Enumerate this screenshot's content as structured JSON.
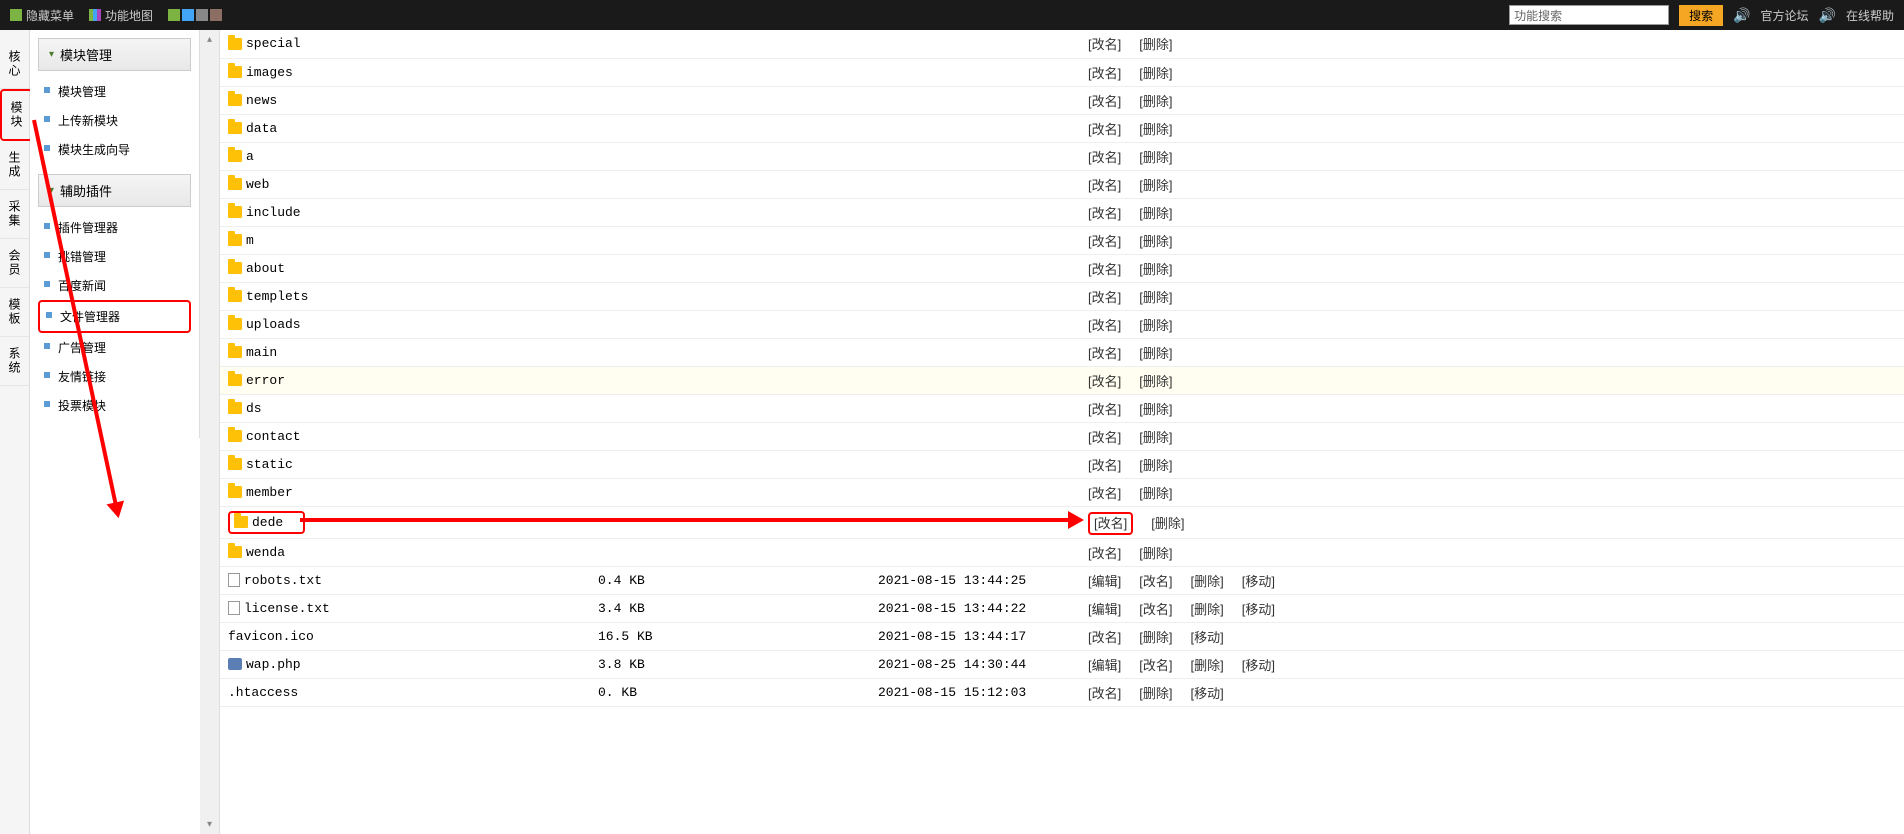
{
  "topbar": {
    "hide_menu": "隐藏菜单",
    "feature_map": "功能地图",
    "search_placeholder": "功能搜索",
    "search_btn": "搜索",
    "official_forum": "官方论坛",
    "online_help": "在线帮助"
  },
  "left_tabs": [
    "核心",
    "模块",
    "生成",
    "采集",
    "会员",
    "模板",
    "系统"
  ],
  "sidebar": {
    "group1_title": "模块管理",
    "group1_items": [
      "模块管理",
      "上传新模块",
      "模块生成向导"
    ],
    "group2_title": "辅助插件",
    "group2_items": [
      "插件管理器",
      "挑错管理",
      "百度新闻",
      "文件管理器",
      "广告管理",
      "友情链接",
      "投票模块"
    ]
  },
  "ops_labels": {
    "rename": "[改名]",
    "delete": "[删除]",
    "edit": "[编辑]",
    "move": "[移动]"
  },
  "files": [
    {
      "type": "folder",
      "name": "special",
      "size": "",
      "date": "",
      "ops": [
        "rename",
        "delete"
      ]
    },
    {
      "type": "folder",
      "name": "images",
      "size": "",
      "date": "",
      "ops": [
        "rename",
        "delete"
      ]
    },
    {
      "type": "folder",
      "name": "news",
      "size": "",
      "date": "",
      "ops": [
        "rename",
        "delete"
      ]
    },
    {
      "type": "folder",
      "name": "data",
      "size": "",
      "date": "",
      "ops": [
        "rename",
        "delete"
      ]
    },
    {
      "type": "folder",
      "name": "a",
      "size": "",
      "date": "",
      "ops": [
        "rename",
        "delete"
      ]
    },
    {
      "type": "folder",
      "name": "web",
      "size": "",
      "date": "",
      "ops": [
        "rename",
        "delete"
      ]
    },
    {
      "type": "folder",
      "name": "include",
      "size": "",
      "date": "",
      "ops": [
        "rename",
        "delete"
      ]
    },
    {
      "type": "folder",
      "name": "m",
      "size": "",
      "date": "",
      "ops": [
        "rename",
        "delete"
      ]
    },
    {
      "type": "folder",
      "name": "about",
      "size": "",
      "date": "",
      "ops": [
        "rename",
        "delete"
      ]
    },
    {
      "type": "folder",
      "name": "templets",
      "size": "",
      "date": "",
      "ops": [
        "rename",
        "delete"
      ]
    },
    {
      "type": "folder",
      "name": "uploads",
      "size": "",
      "date": "",
      "ops": [
        "rename",
        "delete"
      ]
    },
    {
      "type": "folder",
      "name": "main",
      "size": "",
      "date": "",
      "ops": [
        "rename",
        "delete"
      ]
    },
    {
      "type": "folder",
      "name": "error",
      "size": "",
      "date": "",
      "ops": [
        "rename",
        "delete"
      ],
      "error": true
    },
    {
      "type": "folder",
      "name": "ds",
      "size": "",
      "date": "",
      "ops": [
        "rename",
        "delete"
      ]
    },
    {
      "type": "folder",
      "name": "contact",
      "size": "",
      "date": "",
      "ops": [
        "rename",
        "delete"
      ]
    },
    {
      "type": "folder",
      "name": "static",
      "size": "",
      "date": "",
      "ops": [
        "rename",
        "delete"
      ]
    },
    {
      "type": "folder",
      "name": "member",
      "size": "",
      "date": "",
      "ops": [
        "rename",
        "delete"
      ]
    },
    {
      "type": "folder",
      "name": "dede",
      "size": "",
      "date": "",
      "ops": [
        "rename",
        "delete"
      ],
      "hl": true
    },
    {
      "type": "folder",
      "name": "wenda",
      "size": "",
      "date": "",
      "ops": [
        "rename",
        "delete"
      ]
    },
    {
      "type": "file",
      "name": "robots.txt",
      "size": "0.4 KB",
      "date": "2021-08-15 13:44:25",
      "ops": [
        "edit",
        "rename",
        "delete",
        "move"
      ]
    },
    {
      "type": "file",
      "name": "license.txt",
      "size": "3.4 KB",
      "date": "2021-08-15 13:44:22",
      "ops": [
        "edit",
        "rename",
        "delete",
        "move"
      ]
    },
    {
      "type": "none",
      "name": "favicon.ico",
      "size": "16.5 KB",
      "date": "2021-08-15 13:44:17",
      "ops": [
        "rename",
        "delete",
        "move"
      ]
    },
    {
      "type": "php",
      "name": "wap.php",
      "size": "3.8 KB",
      "date": "2021-08-25 14:30:44",
      "ops": [
        "edit",
        "rename",
        "delete",
        "move"
      ]
    },
    {
      "type": "none",
      "name": ".htaccess",
      "size": "0. KB",
      "date": "2021-08-15 15:12:03",
      "ops": [
        "rename",
        "delete",
        "move"
      ]
    }
  ]
}
